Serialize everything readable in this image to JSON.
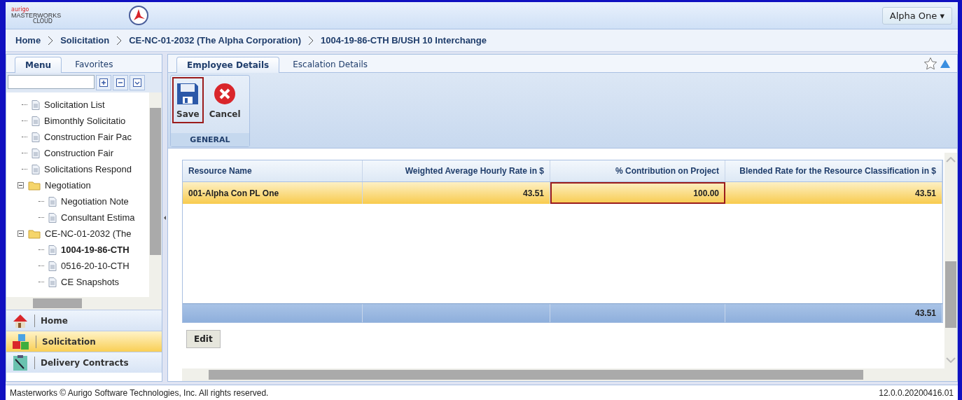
{
  "header": {
    "logo_small": "aurigo",
    "logo": "MASTERWORKS",
    "logo_sub": "CLOUD",
    "user_menu": "Alpha One ▾"
  },
  "breadcrumb": [
    "Home",
    "Solicitation",
    "CE-NC-01-2032 (The Alpha Corporation)",
    "1004-19-86-CTH B/USH 10 Interchange"
  ],
  "sidebar": {
    "tabs": [
      {
        "label": "Menu",
        "selected": true
      },
      {
        "label": "Favorites",
        "selected": false
      }
    ],
    "tree": [
      {
        "label": "Solicitation List",
        "kind": "page",
        "selected": false
      },
      {
        "label": "Bimonthly Solicitatio",
        "kind": "page",
        "selected": false
      },
      {
        "label": "Construction Fair Pac",
        "kind": "page",
        "selected": false
      },
      {
        "label": "Construction Fair",
        "kind": "page",
        "selected": false
      },
      {
        "label": "Solicitations Respond",
        "kind": "page",
        "selected": false
      },
      {
        "label": "Negotiation",
        "kind": "folder",
        "expanded": true,
        "selected": false,
        "children": [
          {
            "label": "Negotiation Note",
            "kind": "page",
            "selected": false
          },
          {
            "label": "Consultant Estima",
            "kind": "page",
            "selected": false
          }
        ]
      },
      {
        "label": "CE-NC-01-2032 (The",
        "kind": "folder",
        "expanded": true,
        "selected": false,
        "children": [
          {
            "label": "1004-19-86-CTH",
            "kind": "page",
            "selected": true
          },
          {
            "label": "0516-20-10-CTH",
            "kind": "page",
            "selected": false
          },
          {
            "label": "CE Snapshots",
            "kind": "page",
            "selected": false
          }
        ]
      }
    ],
    "modules": [
      {
        "label": "Home",
        "kind": "home",
        "selected": false
      },
      {
        "label": "Solicitation",
        "kind": "blocks",
        "selected": true
      },
      {
        "label": "Delivery Contracts",
        "kind": "contracts",
        "selected": false
      }
    ]
  },
  "tabs": [
    {
      "label": "Employee Details",
      "selected": true
    },
    {
      "label": "Escalation Details",
      "selected": false
    }
  ],
  "ribbon": {
    "buttons": [
      {
        "label": "Save",
        "kind": "save",
        "outlined": true
      },
      {
        "label": "Cancel",
        "kind": "cancel",
        "outlined": false
      }
    ],
    "group": "GENERAL"
  },
  "table": {
    "columns": [
      "Resource Name",
      "Weighted Average Hourly Rate in $",
      "% Contribution on Project",
      "Blended Rate for the Resource Classification in $"
    ],
    "rows": [
      {
        "selected": true,
        "cells": [
          {
            "text": "001-Alpha Con PL One",
            "outlined": false
          },
          {
            "text": "43.51",
            "outlined": false
          },
          {
            "text": "100.00",
            "outlined": true
          },
          {
            "text": "43.51",
            "outlined": false
          }
        ]
      }
    ],
    "footer_total": "43.51"
  },
  "edit_button": "Edit",
  "status_bar": {
    "copyright": "Masterworks © Aurigo Software Technologies, Inc. All rights reserved.",
    "version": "12.0.0.20200416.01"
  }
}
